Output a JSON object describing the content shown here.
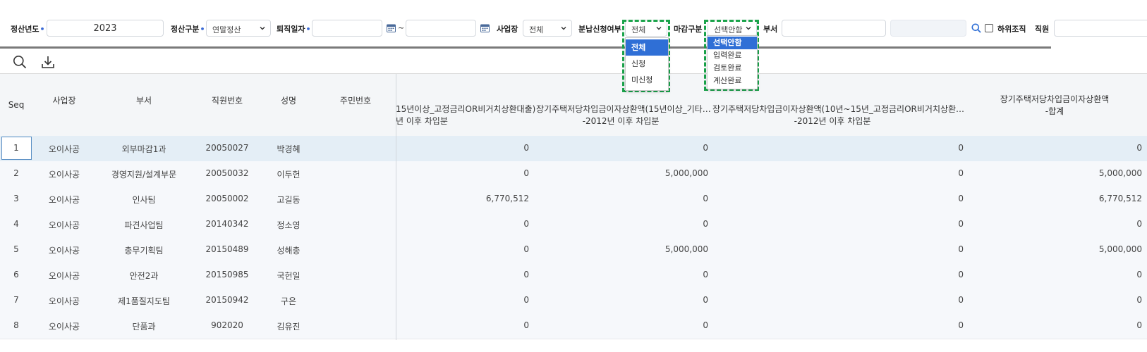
{
  "filters": {
    "year_label": "정산년도",
    "year_value": "2023",
    "type_label": "정산구분",
    "type_value": "연말정산",
    "retire_label": "퇴직일자",
    "retire_from": "",
    "retire_to": "",
    "tilde": "~",
    "site_label": "사업장",
    "site_value": "전체",
    "installment_label": "분납신청여부",
    "installment_value": "전체",
    "close_label": "마감구분",
    "close_value": "선택안함",
    "dept_label": "부서",
    "dept_value": "",
    "suborg_label": "하위조직",
    "employee_label": "직원",
    "required_mark": "•"
  },
  "installment_options": [
    "전체",
    "신청",
    "미신청"
  ],
  "installment_selected_index": 0,
  "close_options": [
    "선택안함",
    "입력완료",
    "검토완료",
    "계산완료"
  ],
  "close_selected_index": 0,
  "columns": {
    "seq": "Seq",
    "site": "사업장",
    "dept": "부서",
    "emp_no": "직원번호",
    "name": "성명",
    "rrn": "주민번호",
    "col_a_1": "15년이상_고정금리OR비거치상환대출)",
    "col_a_2": "년 이후 차입분",
    "col_b_1": "장기주택저당차입금이자상환액(15년이상_기타…",
    "col_b_2": "-2012년 이후 차입분",
    "col_c_1": "장기주택저당차입금이자상환액(10년~15년_고정금리OR비거치상환…",
    "col_c_2": "-2012년 이후 차입분",
    "col_d_1": "장기주택저당차입금이자상환액",
    "col_d_2": "-합계"
  },
  "rows": [
    {
      "seq": "1",
      "site": "오이사공",
      "dept": "외부마감1과",
      "emp_no": "20050027",
      "name": "박경혜",
      "a": "0",
      "b": "0",
      "c": "0",
      "d": "0"
    },
    {
      "seq": "2",
      "site": "오이사공",
      "dept": "경영지원/설계부문",
      "emp_no": "20050032",
      "name": "이두헌",
      "a": "0",
      "b": "5,000,000",
      "c": "0",
      "d": "5,000,000"
    },
    {
      "seq": "3",
      "site": "오이사공",
      "dept": "인사팀",
      "emp_no": "20050002",
      "name": "고길동",
      "a": "6,770,512",
      "b": "0",
      "c": "0",
      "d": "6,770,512"
    },
    {
      "seq": "4",
      "site": "오이사공",
      "dept": "파견사업팀",
      "emp_no": "20140342",
      "name": "정소영",
      "a": "0",
      "b": "0",
      "c": "0",
      "d": "0"
    },
    {
      "seq": "5",
      "site": "오이사공",
      "dept": "총무기획팀",
      "emp_no": "20150489",
      "name": "성해총",
      "a": "0",
      "b": "5,000,000",
      "c": "0",
      "d": "5,000,000"
    },
    {
      "seq": "6",
      "site": "오이사공",
      "dept": "안전2과",
      "emp_no": "20150985",
      "name": "국헌일",
      "a": "0",
      "b": "0",
      "c": "0",
      "d": "0"
    },
    {
      "seq": "7",
      "site": "오이사공",
      "dept": "제1품질지도팀",
      "emp_no": "20150942",
      "name": "구은",
      "a": "0",
      "b": "0",
      "c": "0",
      "d": "0"
    },
    {
      "seq": "8",
      "site": "오이사공",
      "dept": "단품과",
      "emp_no": "902020",
      "name": "김유진",
      "a": "0",
      "b": "0",
      "c": "0",
      "d": "0"
    }
  ],
  "colors": {
    "required": "#3b6bd6",
    "accent": "#2f6fd6",
    "dashed_frame": "#1aa34a",
    "selected_row": "#e4eef6"
  },
  "icons": [
    "search-icon",
    "download-icon",
    "calendar-icon",
    "chevron-down-icon"
  ]
}
